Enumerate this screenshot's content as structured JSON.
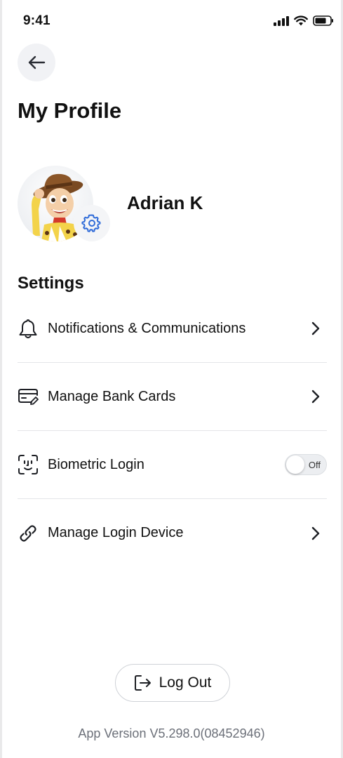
{
  "status_bar": {
    "time": "9:41",
    "icons": [
      "cellular-signal-icon",
      "wifi-icon",
      "battery-icon"
    ]
  },
  "header": {
    "back_icon": "arrow-left-icon",
    "title": "My Profile"
  },
  "profile": {
    "name": "Adrian K",
    "avatar_icon": "cowboy-avatar",
    "settings_icon": "gear-icon",
    "accent_color": "#2f6bd8"
  },
  "settings": {
    "title": "Settings",
    "items": [
      {
        "icon": "bell-icon",
        "label": "Notifications & Communications",
        "control": "chevron-right-icon"
      },
      {
        "icon": "card-edit-icon",
        "label": "Manage Bank Cards",
        "control": "chevron-right-icon"
      },
      {
        "icon": "face-id-icon",
        "label": "Biometric Login",
        "control": "toggle",
        "toggle_state": "Off"
      },
      {
        "icon": "link-icon",
        "label": "Manage Login Device",
        "control": "chevron-right-icon"
      }
    ]
  },
  "footer": {
    "logout_icon": "logout-icon",
    "logout_label": "Log Out",
    "app_version": "App Version V5.298.0(08452946)"
  }
}
